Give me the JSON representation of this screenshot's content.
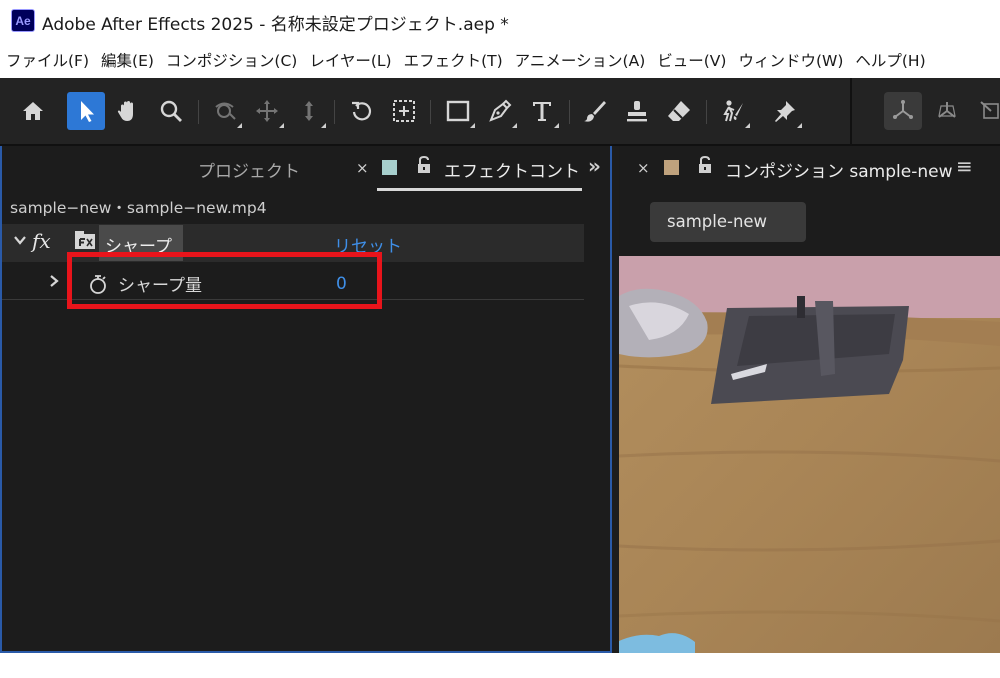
{
  "window": {
    "app_icon": "Ae",
    "title": "Adobe After Effects 2025 - 名称未設定プロジェクト.aep *"
  },
  "menu": [
    "ファイル(F)",
    "編集(E)",
    "コンポジション(C)",
    "レイヤー(L)",
    "エフェクト(T)",
    "アニメーション(A)",
    "ビュー(V)",
    "ウィンドウ(W)",
    "ヘルプ(H)"
  ],
  "toolbar": {
    "tools": [
      "home-icon",
      "selection-arrow-icon",
      "hand-icon",
      "zoom-icon",
      "orbit-camera-icon",
      "pan-camera-icon",
      "dolly-camera-icon",
      "rotate-icon",
      "pan-behind-icon",
      "rectangle-icon",
      "pen-icon",
      "type-icon",
      "brush-icon",
      "clone-stamp-icon",
      "eraser-icon",
      "roto-brush-icon",
      "puppet-pin-icon"
    ],
    "selected_tool": "selection-arrow-icon"
  },
  "left_panel": {
    "tab_project": "プロジェクト",
    "tab_effect_controls": "エフェクトコントロ-",
    "tab_close": "×",
    "tab_overflow": "»",
    "layer_path": "sample−new・sample−new.mp4",
    "effect": {
      "fx_label": "fx",
      "name": "シャープ",
      "reset_label": "リセット",
      "param_name": "シャープ量",
      "param_value": "0"
    }
  },
  "right_panel": {
    "close": "×",
    "title": "コンポジション sample-new",
    "menu_icon": "≡",
    "comp_tab": "sample-new"
  },
  "colors": {
    "accent_blue": "#2d78d6",
    "value_blue": "#3f8fe8",
    "highlight_red": "#e8141b",
    "effect_swatch": "#a7cfcd",
    "comp_swatch": "#bfa27d"
  }
}
